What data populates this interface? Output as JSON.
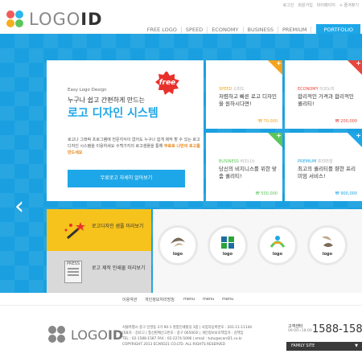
{
  "header": {
    "logo_text": "LOGO",
    "logo_text_bold": "ID",
    "util_links": [
      "로그인",
      "회원가입",
      "마이페이지",
      "+ 즐겨찾기"
    ],
    "nav": [
      "FREE LOGO",
      "SPEED",
      "ECONOMY",
      "BUSINESS",
      "PREMIUM"
    ],
    "portfolio_label": "PORTFOLIO"
  },
  "hero": {
    "badge": "free",
    "eyebrow": "Easy Logo Design",
    "line1": "누구나 쉽고 간편하게 만드는",
    "line2": "로고 디자인 시스템",
    "body": "로고나 그래픽 프로그램에 전문지식이 없어도 누구나 쉽게 제작 할 수 있는 로고 디자인 시스템을 이용하세요 수백가지의 로고샘플을 통해",
    "body_highlight": "무료로 나만의 로고를 만드세요",
    "button_label": "무료로고 자세히 알아보기",
    "arrow_label": "‹"
  },
  "tiles": [
    {
      "cat_en": "SPEED",
      "cat_ko": "스피드",
      "title": "저렴하고 빠른 로고 디자인을 원하시다면!",
      "price": "₩ 70,000",
      "color": "#f6a41c"
    },
    {
      "cat_en": "ECONOMY",
      "cat_ko": "이코노미",
      "title": "합리적인 가격과 합리적인 퀄리티!",
      "price": "₩ 200,000",
      "color": "#e8463c"
    },
    {
      "cat_en": "BUSINESS",
      "cat_ko": "비즈니스",
      "title": "당신의 비지니스를 위한 맞춤 퀄리티!",
      "price": "₩ 500,000",
      "color": "#5cc65c"
    },
    {
      "cat_en": "PREMIUM",
      "cat_ko": "프리미엄",
      "title": "최고의 퀄리티를 향한 프리미엄 서비스!",
      "price": "₩ 900,000",
      "color": "#1ea7e8"
    }
  ],
  "promos": [
    {
      "text": "로고디자인 샘플 미리보기"
    },
    {
      "text": "로고 제작 인쇄물 미리보기",
      "icon_label": "PRESS"
    }
  ],
  "sample_logos": [
    "logo",
    "logo",
    "logo",
    "logo"
  ],
  "footer": {
    "links": [
      "이용약관",
      "개인정보처리방침",
      "menu",
      "menu",
      "menu"
    ],
    "logo_text": "LOGO",
    "logo_text_bold": "ID",
    "address_lines": [
      "서울특별시 중구 인현동 2가 90-1 명함인쇄빌딩 3층 | 사업자등록번호 : 201-11-11144",
      "대표자 : 김로고 | 통신판매신고번호 : 중구 06500호 | 개인정보보호책임자 : 김책임",
      "TEL : 02-1588-1587 FAX : 02-2274-5006 | email : tutu@ecard21.co.kr",
      "COPYRIGHT 2013 ECARD21 CO.LTD. ALL RIGHTS RESERVED"
    ],
    "cs_label": "고객센터",
    "cs_hours": "09:00~18:00",
    "cs_phone": "1588-1587",
    "family_site": "FAMILY SITE"
  }
}
